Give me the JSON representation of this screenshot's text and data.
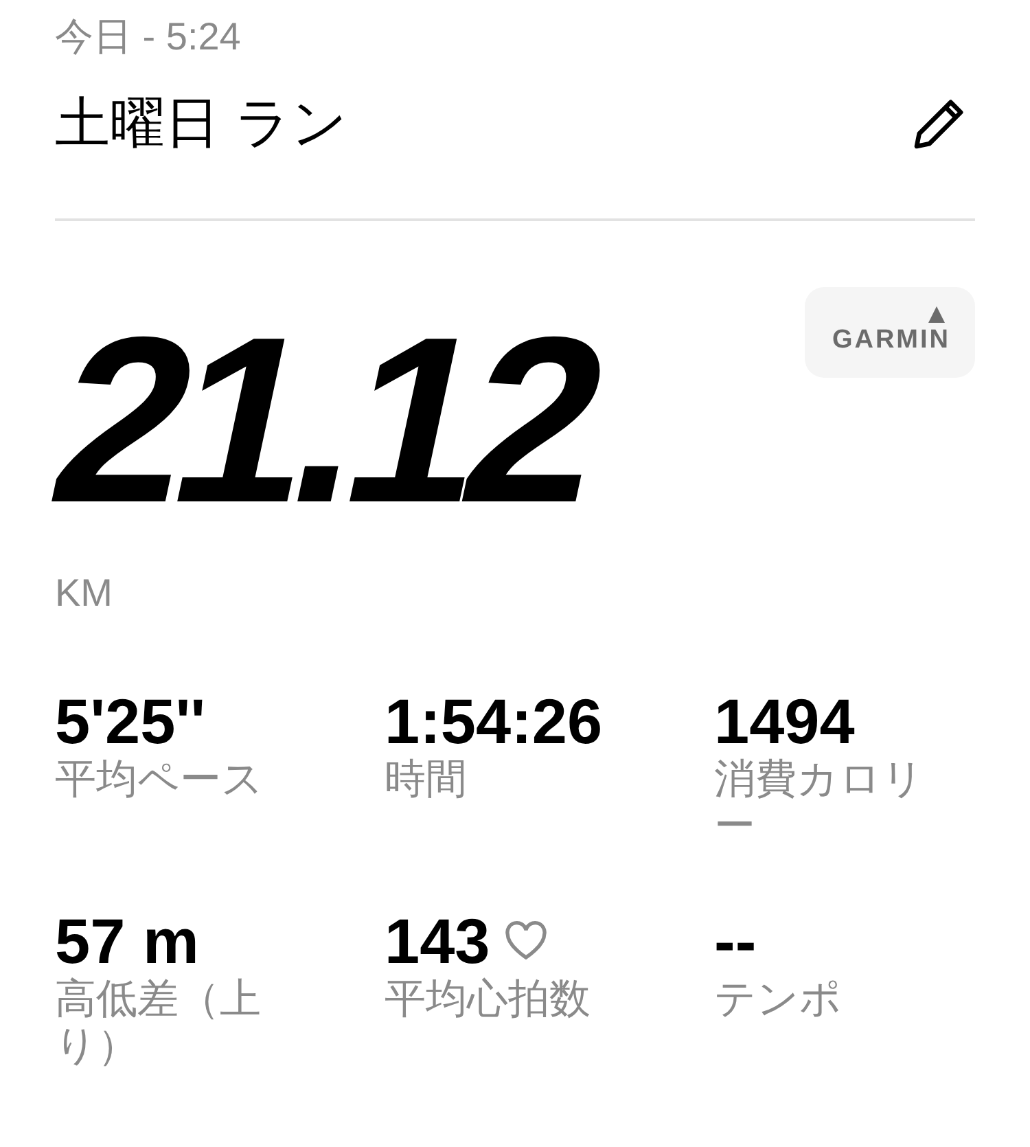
{
  "header": {
    "date": "今日 - 5:24",
    "title": "土曜日 ラン"
  },
  "source_badge": "GARMIN",
  "distance": {
    "value": "21.12",
    "unit": "KM"
  },
  "stats": [
    {
      "kind": "plain",
      "value": "5'25''",
      "label": "平均ペース"
    },
    {
      "kind": "plain",
      "value": "1:54:26",
      "label": "時間"
    },
    {
      "kind": "plain",
      "value": "1494",
      "label": "消費カロリー"
    },
    {
      "kind": "plain",
      "value": "57 m",
      "label": "高低差（上り）"
    },
    {
      "kind": "heart_rate",
      "value": "143",
      "label": "平均心拍数"
    },
    {
      "kind": "plain",
      "value": "--",
      "label": "テンポ"
    }
  ]
}
